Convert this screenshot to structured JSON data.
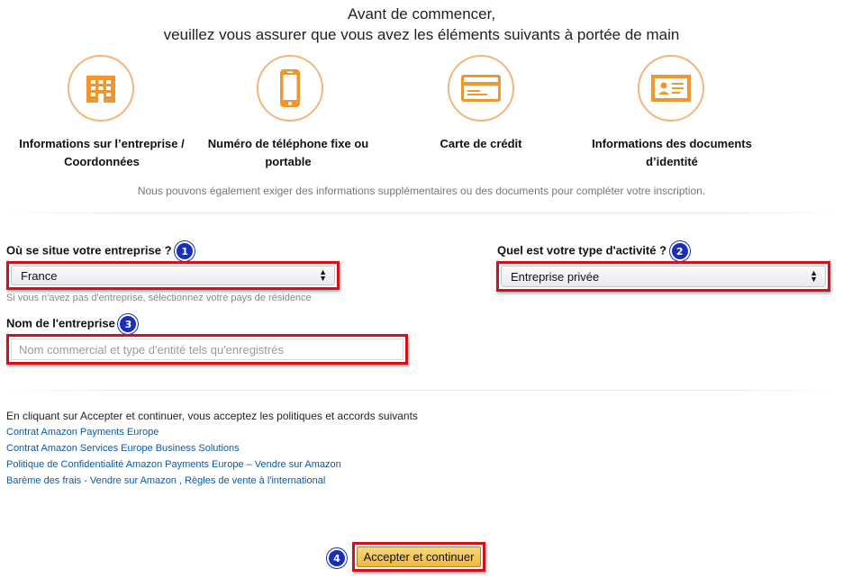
{
  "header": {
    "line1": "Avant de commencer,",
    "line2": "veuillez vous assurer que vous avez les éléments suivants à portée de main"
  },
  "requirements": [
    {
      "icon": "building-icon",
      "label_line1": "Informations sur l’entreprise /",
      "label_line2": "Coordonnées"
    },
    {
      "icon": "phone-icon",
      "label_line1": "Numéro de téléphone fixe ou",
      "label_line2": "portable"
    },
    {
      "icon": "credit-card-icon",
      "label_line1": "Carte de crédit",
      "label_line2": ""
    },
    {
      "icon": "id-card-icon",
      "label_line1": "Informations des documents",
      "label_line2": "d’identité"
    }
  ],
  "extra_note": "Nous pouvons également exiger des informations supplémentaires ou des documents pour compléter votre inscription.",
  "form": {
    "location": {
      "label": "Où se situe votre entreprise ?",
      "badge": "1",
      "value": "France",
      "hint": "Si vous n'avez pas d'entreprise, sélectionnez votre pays de résidence"
    },
    "activity": {
      "label": "Quel est votre type d'activité ?",
      "badge": "2",
      "value": "Entreprise privée"
    },
    "company_name": {
      "label": "Nom de l'entreprise",
      "badge": "3",
      "placeholder": "Nom commercial et type d'entité tels qu'enregistrés"
    }
  },
  "policies": {
    "intro": "En cliquant sur Accepter et continuer, vous acceptez les politiques et accords suivants",
    "links": [
      "Contrat Amazon Payments Europe",
      "Contrat Amazon Services Europe Business Solutions",
      "Politique de Confidentialité Amazon Payments Europe – Vendre sur Amazon",
      "Barème des frais - Vendre sur Amazon , Règles de vente à l'international"
    ]
  },
  "submit": {
    "badge": "4",
    "label": "Accepter et continuer"
  },
  "colors": {
    "icon_orange": "#f0962e",
    "circle_border": "#f2b57a",
    "highlight_red": "#d1121b",
    "badge_blue": "#1a2fb8",
    "link_blue": "#0a5aa7",
    "button_gold": "#efb93b"
  }
}
